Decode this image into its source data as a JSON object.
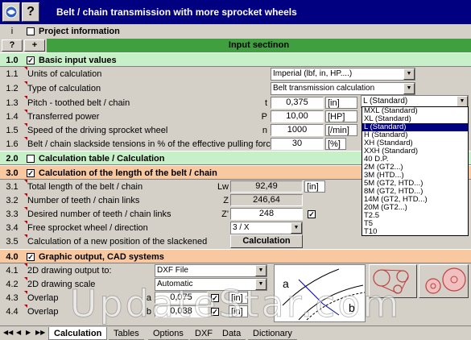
{
  "title": "Belt / chain transmission with more sprocket wheels",
  "project_info": {
    "num": "i",
    "label": "Project information"
  },
  "input_header": {
    "q": "?",
    "plus": "+",
    "label": "Input sectinon"
  },
  "sections": {
    "s1": {
      "num": "1.0",
      "label": "Basic input values"
    },
    "s2": {
      "num": "2.0",
      "label": "Calculation table / Calculation"
    },
    "s3": {
      "num": "3.0",
      "label": "Calculation of the length of the belt / chain"
    },
    "s4": {
      "num": "4.0",
      "label": "Graphic output, CAD systems"
    }
  },
  "rows": {
    "r11": {
      "num": "1.1",
      "label": "Units of calculation",
      "value": "Imperial (lbf, in, HP....)"
    },
    "r12": {
      "num": "1.2",
      "label": "Type of calculation",
      "value": "Belt transmission calculation"
    },
    "r13": {
      "num": "1.3",
      "label": "Pitch - toothed belt / chain",
      "sym": "t",
      "value": "0,375",
      "unit": "[in]",
      "combo": "L (Standard)"
    },
    "r14": {
      "num": "1.4",
      "label": "Transferred power",
      "sym": "P",
      "value": "10,00",
      "unit": "[HP]"
    },
    "r15": {
      "num": "1.5",
      "label": "Speed of the driving sprocket wheel",
      "sym": "n",
      "value": "1000",
      "unit": "[/min]"
    },
    "r16": {
      "num": "1.6",
      "label": "Belt / chain slackside tensions in % of the effective pulling force",
      "value": "30",
      "unit": "[%]"
    },
    "r31": {
      "num": "3.1",
      "label": "Total length of the belt / chain",
      "sym": "Lw",
      "value": "92,49",
      "unit": "[in]"
    },
    "r32": {
      "num": "3.2",
      "label": "Number of teeth / chain links",
      "sym": "Z",
      "value": "246,64"
    },
    "r33": {
      "num": "3.3",
      "label": "Desired number of teeth / chain links",
      "sym": "Z'",
      "value": "248"
    },
    "r34": {
      "num": "3.4",
      "label": "Free sprocket wheel / direction",
      "value": "3 / X"
    },
    "r35": {
      "num": "3.5",
      "label": "Calculation of a new position of the slackened",
      "button": "Calculation"
    },
    "r41": {
      "num": "4.1",
      "label": "2D drawing output to:",
      "value": "DXF File"
    },
    "r42": {
      "num": "4.2",
      "label": "2D drawing scale",
      "value": "Automatic"
    },
    "r43": {
      "num": "4.3",
      "label": "Overlap",
      "sym": "a",
      "value": "0,075",
      "unit": "[in]"
    },
    "r44": {
      "num": "4.4",
      "label": "Overlap",
      "sym": "b",
      "value": "0,038",
      "unit": "[in]"
    }
  },
  "dropdown_options": [
    "MXL (Standard)",
    "XL (Standard)",
    "L (Standard)",
    "H (Standard)",
    "XH (Standard)",
    "XXH (Standard)",
    "40 D.P.",
    "2M (GT2...)",
    "3M (HTD...)",
    "5M (GT2, HTD...)",
    "8M (GT2, HTD...)",
    "14M (GT2, HTD...)",
    "20M (GT2...)",
    "T2.5",
    "T5",
    "T10"
  ],
  "dropdown_selected": 2,
  "diagram": {
    "a": "a",
    "b": "b"
  },
  "tabs": [
    "Calculation",
    "Tables",
    "Options",
    "DXF",
    "Data",
    "Dictionary"
  ],
  "watermark": "UpdateStar.com",
  "colors": {
    "titlebar": "#000080",
    "section": "#c8f0c8",
    "orange": "#f8c8a0",
    "input_header": "#40a040"
  }
}
